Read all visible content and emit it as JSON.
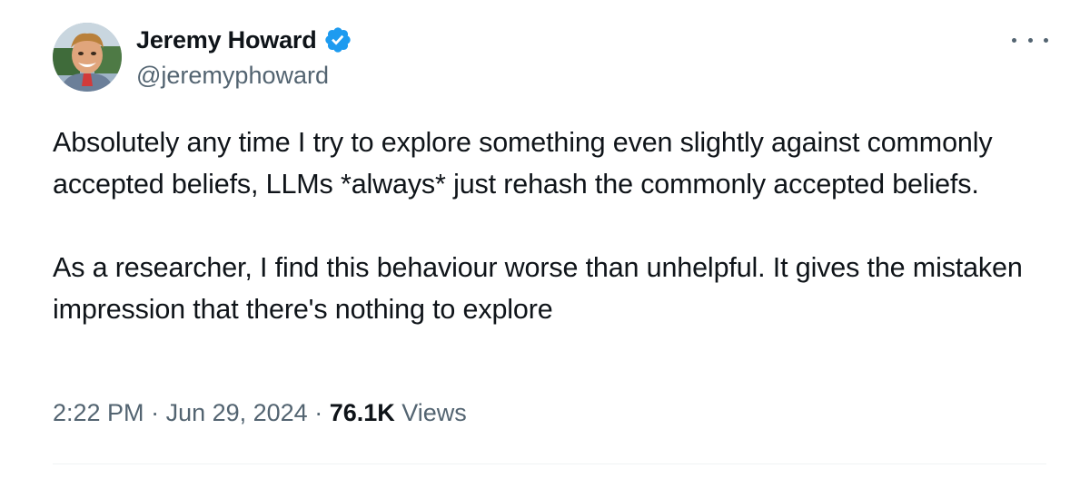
{
  "author": {
    "display_name": "Jeremy Howard",
    "handle": "@jeremyphoward",
    "verified": true,
    "avatar_icon": "profile-photo",
    "verified_color": "#1d9bf0"
  },
  "more_icon": "ellipsis-icon",
  "tweet": {
    "paragraph_1": "Absolutely any time I try to explore something even slightly against commonly accepted beliefs, LLMs *always* just rehash the commonly accepted beliefs.",
    "paragraph_2": "As a researcher, I find this behaviour worse than unhelpful. It gives the mistaken impression that there's nothing to explore"
  },
  "meta": {
    "time": "2:22 PM",
    "separator_1": " · ",
    "date": "Jun 29, 2024",
    "separator_2": " · ",
    "views_count": "76.1K",
    "views_label": " Views"
  },
  "colors": {
    "text": "#0f1419",
    "secondary": "#536471",
    "divider": "#eff3f4"
  }
}
